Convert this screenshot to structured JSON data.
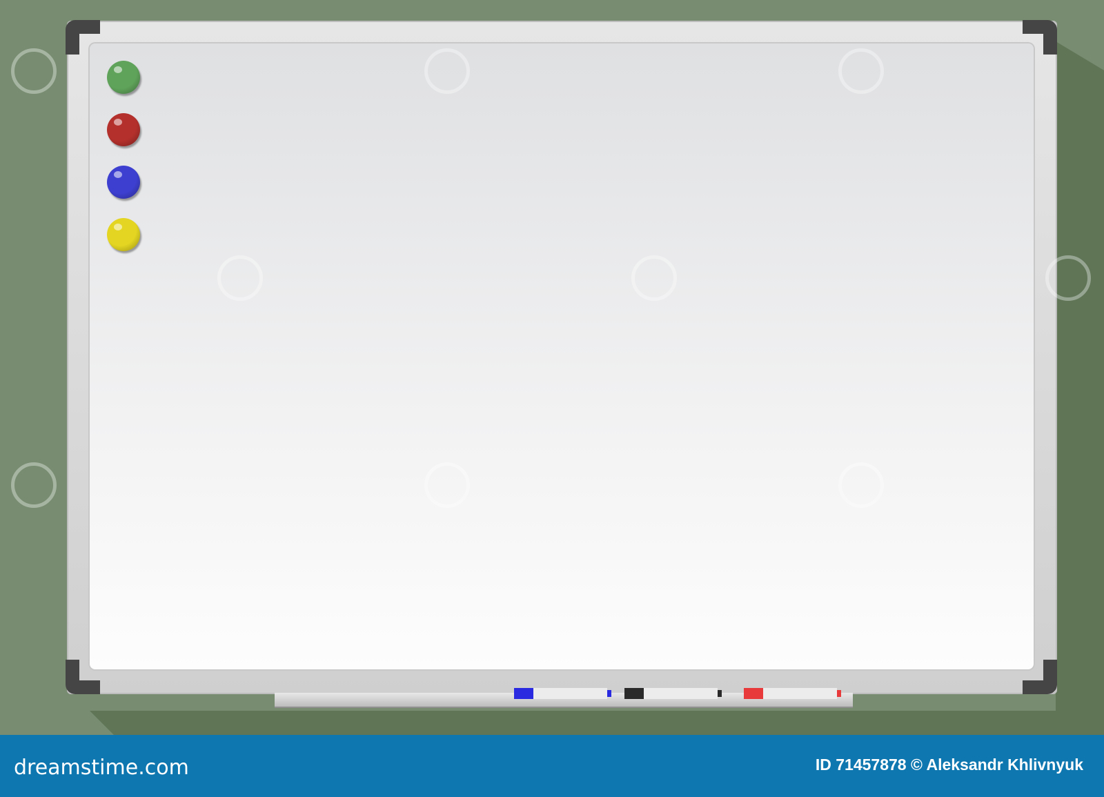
{
  "magnets": [
    {
      "name": "green",
      "color": "#5fa35a"
    },
    {
      "name": "red",
      "color": "#b3302c"
    },
    {
      "name": "blue",
      "color": "#3d3fd0"
    },
    {
      "name": "yellow",
      "color": "#e3d521"
    }
  ],
  "markers": [
    {
      "name": "blue",
      "color": "#2a2ae0"
    },
    {
      "name": "black",
      "color": "#2a2a2a"
    },
    {
      "name": "red",
      "color": "#e83a3a"
    }
  ],
  "footer": {
    "logo": "dreamstime.com",
    "credit": "ID 71457878 © Aleksandr Khlivnyuk"
  }
}
